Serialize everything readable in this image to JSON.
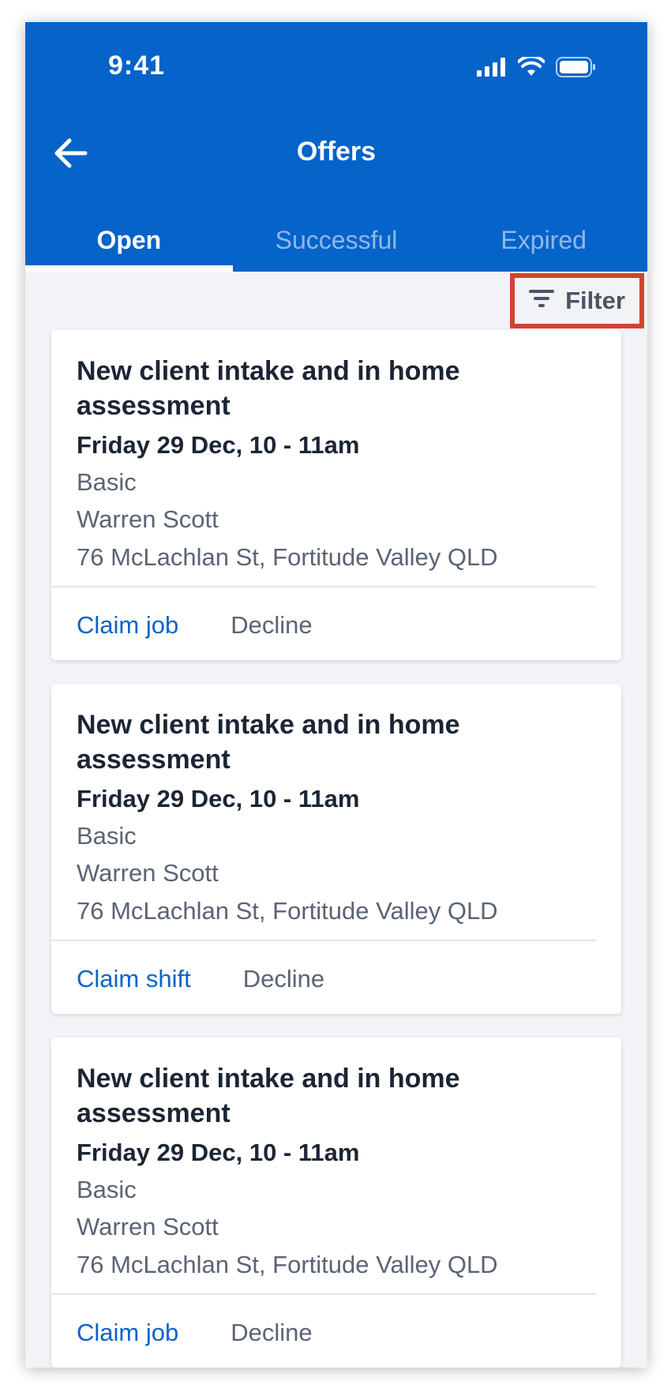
{
  "status_bar": {
    "time": "9:41"
  },
  "header": {
    "title": "Offers"
  },
  "tabs": [
    {
      "label": "Open",
      "active": true
    },
    {
      "label": "Successful",
      "active": false
    },
    {
      "label": "Expired",
      "active": false
    }
  ],
  "filter": {
    "label": "Filter"
  },
  "offers": [
    {
      "title": "New client intake and in home assessment",
      "date": "Friday 29 Dec, 10 - 11am",
      "plan": "Basic",
      "client": "Warren Scott",
      "address": "76 McLachlan St, Fortitude Valley QLD",
      "claim_label": "Claim job",
      "decline_label": "Decline"
    },
    {
      "title": "New client intake and in home assessment",
      "date": "Friday 29 Dec, 10 - 11am",
      "plan": "Basic",
      "client": "Warren Scott",
      "address": "76 McLachlan St, Fortitude Valley QLD",
      "claim_label": "Claim shift",
      "decline_label": "Decline"
    },
    {
      "title": "New client intake and in home assessment",
      "date": "Friday 29 Dec, 10 - 11am",
      "plan": "Basic",
      "client": "Warren Scott",
      "address": "76 McLachlan St, Fortitude Valley QLD",
      "claim_label": "Claim job",
      "decline_label": "Decline"
    }
  ],
  "colors": {
    "header_bg": "#0563c9",
    "accent": "#0a63c7",
    "highlight_border": "#d2432e"
  },
  "icons": [
    "signal-icon",
    "wifi-icon",
    "battery-icon",
    "back-arrow-icon",
    "filter-icon"
  ]
}
